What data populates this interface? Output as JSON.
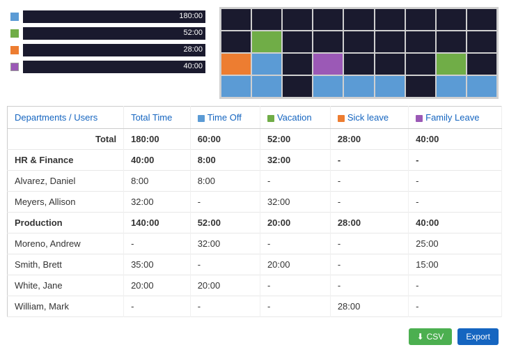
{
  "header": {
    "legend": [
      {
        "color": "#5b9bd5",
        "label": "180:00",
        "fill": 90
      },
      {
        "color": "#70ad47",
        "label": "52:00",
        "fill": 30
      },
      {
        "color": "#ed7d31",
        "label": "28:00",
        "fill": 16
      },
      {
        "color": "#9b59b6",
        "label": "40:00",
        "fill": 24
      }
    ]
  },
  "table": {
    "columns": [
      {
        "label": "Departments / Users",
        "color": null
      },
      {
        "label": "Total Time",
        "color": null
      },
      {
        "label": "Time Off",
        "color": "#5b9bd5"
      },
      {
        "label": "Vacation",
        "color": "#70ad47"
      },
      {
        "label": "Sick leave",
        "color": "#ed7d31"
      },
      {
        "label": "Family Leave",
        "color": "#9b59b6"
      }
    ],
    "rows": [
      {
        "name": "Total",
        "total": "180:00",
        "timeoff": "60:00",
        "vacation": "52:00",
        "sick": "28:00",
        "family": "40:00",
        "type": "total"
      },
      {
        "name": "HR & Finance",
        "total": "40:00",
        "timeoff": "8:00",
        "vacation": "32:00",
        "sick": "-",
        "family": "-",
        "type": "dept"
      },
      {
        "name": "Alvarez, Daniel",
        "total": "8:00",
        "timeoff": "8:00",
        "vacation": "-",
        "sick": "-",
        "family": "-",
        "type": "user"
      },
      {
        "name": "Meyers, Allison",
        "total": "32:00",
        "timeoff": "-",
        "vacation": "32:00",
        "sick": "-",
        "family": "-",
        "type": "user"
      },
      {
        "name": "Production",
        "total": "140:00",
        "timeoff": "52:00",
        "vacation": "20:00",
        "sick": "28:00",
        "family": "40:00",
        "type": "dept"
      },
      {
        "name": "Moreno, Andrew",
        "total": "-",
        "timeoff": "32:00",
        "vacation": "-",
        "sick": "-",
        "family": "25:00",
        "type": "user"
      },
      {
        "name": "Smith, Brett",
        "total": "35:00",
        "timeoff": "-",
        "vacation": "20:00",
        "sick": "-",
        "family": "15:00",
        "type": "user"
      },
      {
        "name": "White, Jane",
        "total": "20:00",
        "timeoff": "20:00",
        "vacation": "-",
        "sick": "-",
        "family": "-",
        "type": "user"
      },
      {
        "name": "William, Mark",
        "total": "-",
        "timeoff": "-",
        "vacation": "-",
        "sick": "28:00",
        "family": "-",
        "type": "user"
      }
    ]
  },
  "buttons": {
    "csv_label": "CSV",
    "export_label": "Export"
  },
  "colors": {
    "blue": "#5b9bd5",
    "green": "#70ad47",
    "orange": "#ed7d31",
    "purple": "#9b59b6"
  }
}
